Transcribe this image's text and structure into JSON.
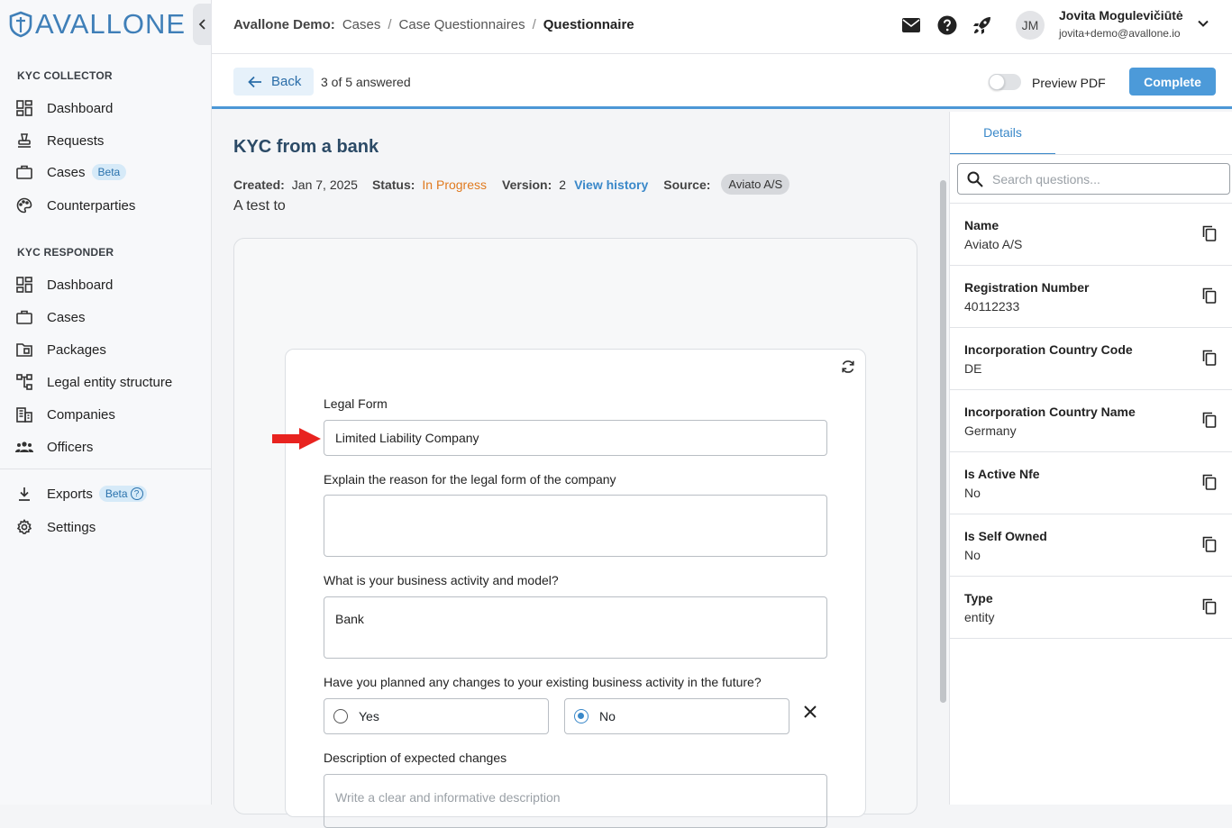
{
  "app": {
    "brand": "AVALLONE"
  },
  "sidebar": {
    "collector_heading": "KYC COLLECTOR",
    "collector_items": [
      {
        "label": "Dashboard",
        "icon": "dashboard-icon"
      },
      {
        "label": "Requests",
        "icon": "stamp-icon"
      },
      {
        "label": "Cases",
        "icon": "briefcase-icon",
        "badge": "Beta"
      },
      {
        "label": "Counterparties",
        "icon": "palette-icon"
      }
    ],
    "responder_heading": "KYC RESPONDER",
    "responder_items": [
      {
        "label": "Dashboard",
        "icon": "dashboard-icon"
      },
      {
        "label": "Cases",
        "icon": "briefcase-icon"
      },
      {
        "label": "Packages",
        "icon": "folder-icon"
      },
      {
        "label": "Legal entity structure",
        "icon": "hierarchy-icon"
      },
      {
        "label": "Companies",
        "icon": "building-icon"
      },
      {
        "label": "Officers",
        "icon": "people-icon"
      }
    ],
    "bottom_items": [
      {
        "label": "Exports",
        "icon": "download-icon",
        "badge": "Beta",
        "badge_help": "?"
      },
      {
        "label": "Settings",
        "icon": "gear-icon"
      }
    ]
  },
  "header": {
    "breadcrumb": [
      "Avallone Demo:",
      "Cases",
      "/",
      "Case Questionnaires",
      "/",
      "Questionnaire"
    ],
    "user": {
      "initials": "JM",
      "name": "Jovita Mogulevičiūtė",
      "email": "jovita+demo@avallone.io"
    }
  },
  "toolbar": {
    "back_label": "Back",
    "answered": "3 of 5 answered",
    "preview_label": "Preview PDF",
    "preview_enabled": false,
    "complete_label": "Complete"
  },
  "questionnaire": {
    "title": "KYC from a bank",
    "created_label": "Created:",
    "created": "Jan 7, 2025",
    "status_label": "Status:",
    "status": "In Progress",
    "version_label": "Version:",
    "version": "2",
    "history_link": "View history",
    "source_label": "Source:",
    "source": "Aviato A/S",
    "description": "A test to",
    "questions": [
      {
        "label": "Legal Form",
        "value": "Limited Liability Company"
      },
      {
        "label": "Explain the reason for the legal form of the company",
        "value": ""
      },
      {
        "label": "What is your business activity and model?",
        "value": "Bank"
      },
      {
        "label": "Have you planned any changes to your existing business activity in the future?",
        "options": [
          "Yes",
          "No"
        ],
        "selected": "No"
      },
      {
        "label": "Description of expected changes",
        "value": "",
        "placeholder": "Write a clear and informative description"
      }
    ]
  },
  "details": {
    "tab_label": "Details",
    "search_placeholder": "Search questions...",
    "rows": [
      {
        "key": "Name",
        "value": "Aviato A/S"
      },
      {
        "key": "Registration Number",
        "value": "40112233"
      },
      {
        "key": "Incorporation Country Code",
        "value": "DE"
      },
      {
        "key": "Incorporation Country Name",
        "value": "Germany"
      },
      {
        "key": "Is Active Nfe",
        "value": "No"
      },
      {
        "key": "Is Self Owned",
        "value": "No"
      },
      {
        "key": "Type",
        "value": "entity"
      }
    ]
  },
  "colors": {
    "accent": "#4c97d6",
    "status": "#e07a1f",
    "arrow": "#e8231f",
    "brand": "#3f7fb8"
  }
}
